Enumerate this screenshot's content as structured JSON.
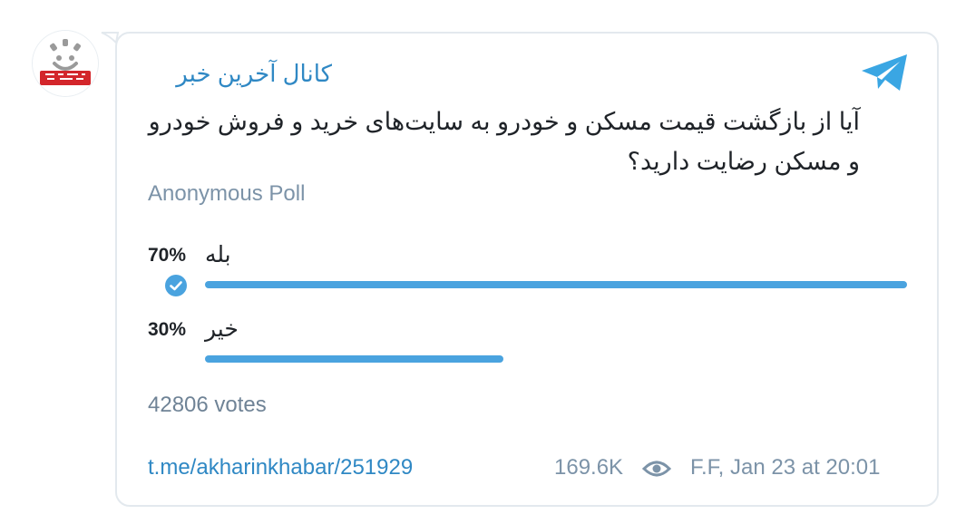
{
  "channel": {
    "avatar_logo_text": "آخرین خبر",
    "name": "کانال آخرین خبر"
  },
  "poll": {
    "question": "آیا از بازگشت قیمت مسکن و خودرو به سایت‌های خرید و فروش خودرو و مسکن رضایت دارید؟",
    "type_label": "Anonymous Poll",
    "options": [
      {
        "label": "بله",
        "percent_text": "70%",
        "fraction": 1.0,
        "selected": true
      },
      {
        "label": "خیر",
        "percent_text": "30%",
        "fraction": 0.425,
        "selected": false
      }
    ],
    "votes_text": "42806 votes"
  },
  "footer": {
    "link": "t.me/akharinkhabar/251929",
    "views": "169.6K",
    "signature_time": "F.F, Jan 23 at 20:01"
  },
  "icons": {
    "platform": "telegram-icon",
    "selected": "check-circle-icon",
    "views": "eye-icon"
  },
  "colors": {
    "accent": "#4aa3df",
    "link": "#2f88c4",
    "muted": "#7c93a8",
    "logo_red": "#d3262b"
  }
}
